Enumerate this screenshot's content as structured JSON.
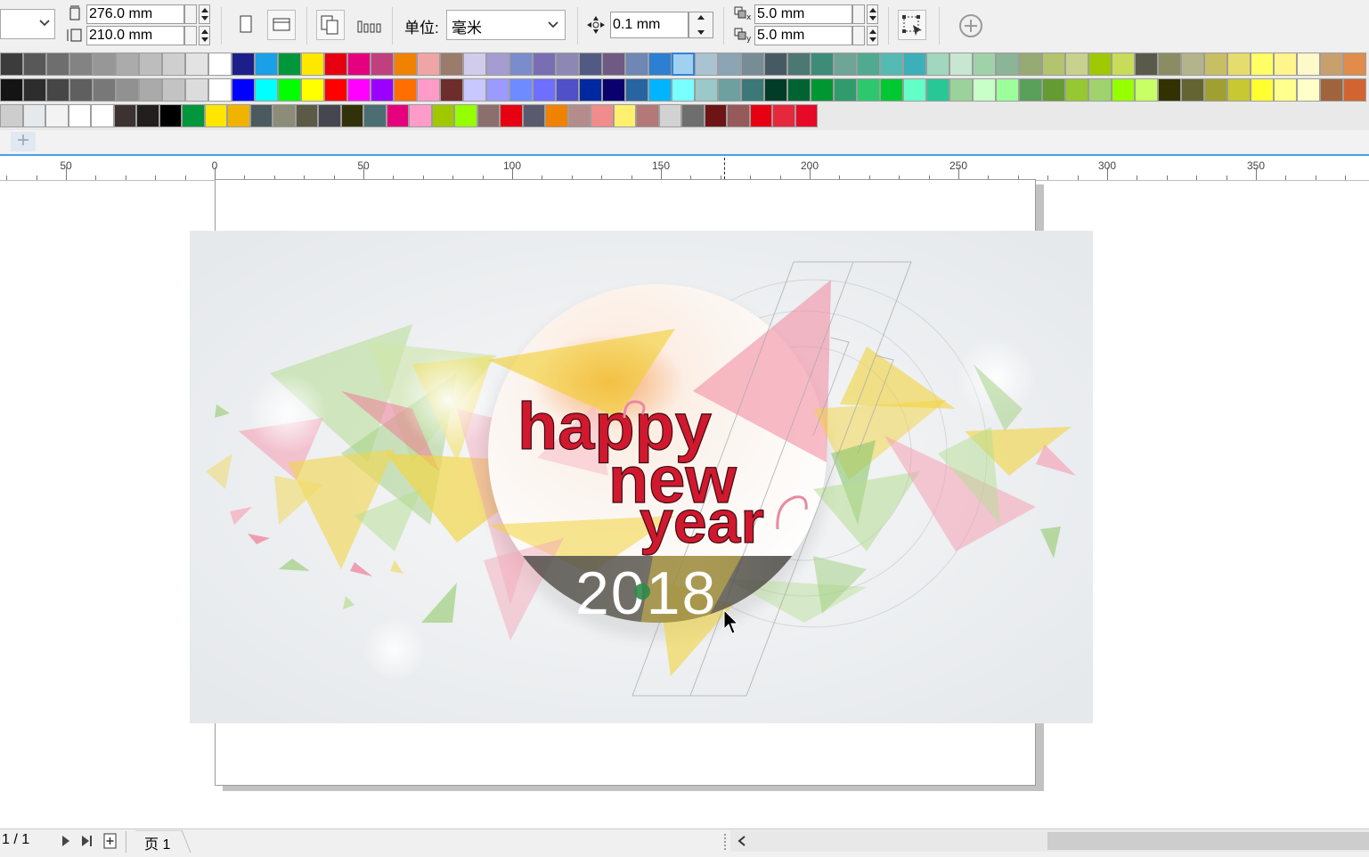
{
  "propbar": {
    "width_value": "276.0 mm",
    "height_value": "210.0 mm",
    "unit_label": "单位:",
    "unit_value": "毫米",
    "nudge_value": "0.1 mm",
    "dup_x_value": "5.0 mm",
    "dup_y_value": "5.0 mm"
  },
  "palette": {
    "row1": [
      "#3c3c3c",
      "#585858",
      "#6e6e6e",
      "#838383",
      "#979797",
      "#ababab",
      "#bdbdbd",
      "#cfcfcf",
      "#e3e3e3",
      "#ffffff",
      "#1c1f8a",
      "#1aa0e6",
      "#00963c",
      "#ffe800",
      "#e60012",
      "#e4007f",
      "#c0407f",
      "#f08200",
      "#f0a5a5",
      "#9b7b6c",
      "#d2ccec",
      "#a59cd2",
      "#7a8ccc",
      "#786eb4",
      "#8c87b4",
      "#505a82",
      "#6e5a82",
      "#6e87b4",
      "#2d7fd2",
      "#a0d2f0",
      "#aac3d2",
      "#8ca5b4",
      "#788c96",
      "#465a64",
      "#4b7873",
      "#3c8c78",
      "#6ea596",
      "#50aa91",
      "#55b9b4",
      "#3cafb9",
      "#a0d7be",
      "#c8e6d2",
      "#a0d2aa",
      "#8cb496",
      "#96aa73",
      "#b4c36e",
      "#c8d28c",
      "#a0c800",
      "#c8dc5a",
      "#5a5a4b",
      "#8c8c64",
      "#b4b48c",
      "#c8be64",
      "#e6dc6e",
      "#ffff64",
      "#fff58c",
      "#fff8c8",
      "#c8a06e",
      "#e18c4b"
    ],
    "row2": [
      "#141414",
      "#2d2d2d",
      "#464646",
      "#5f5f5f",
      "#787878",
      "#919191",
      "#aaaaaa",
      "#c3c3c3",
      "#dcdcdc",
      "#ffffff",
      "#0000ff",
      "#00ffff",
      "#00ff00",
      "#ffff00",
      "#ff0000",
      "#ff00ff",
      "#9b00ff",
      "#ff6e00",
      "#ff9bc8",
      "#6e2d2d",
      "#c8c8ff",
      "#9b9bff",
      "#6e8cff",
      "#6e6eff",
      "#5050c8",
      "#0028a0",
      "#0a006e",
      "#2864a0",
      "#00b4ff",
      "#78ffff",
      "#9bc8c8",
      "#6ea0a0",
      "#3c7878",
      "#003c28",
      "#006432",
      "#009632",
      "#329b6e",
      "#2dc86e",
      "#00c832",
      "#64ffc8",
      "#28c896",
      "#9bd29b",
      "#c8ffc8",
      "#9bff9b",
      "#5aa05a",
      "#649b32",
      "#96c832",
      "#a0d26e",
      "#96ff00",
      "#c8ff64",
      "#323200",
      "#646432",
      "#a0a032",
      "#c8c832",
      "#ffff32",
      "#ffff8c",
      "#ffffc8",
      "#a0643c",
      "#d26432"
    ],
    "row3": [
      "#cdcdcd",
      "#e6e9ec",
      "#f3f3f3",
      "#ffffff",
      "#ffffff",
      "#3c3232",
      "#231e1e",
      "#000000",
      "#00963c",
      "#ffe600",
      "#f0b400",
      "#4b5a5f",
      "#8c8c78",
      "#5a5a46",
      "#464650",
      "#32320a",
      "#4b6e73",
      "#e6007d",
      "#ff9bc8",
      "#a0c800",
      "#96ff00",
      "#8c6e6e",
      "#e60012",
      "#5a5a6e",
      "#f08200",
      "#b48c8c",
      "#f08c8c",
      "#fff06e",
      "#b47878",
      "#d2d2d2",
      "#6e6e6e",
      "#6e1414",
      "#965a5a",
      "#e60012",
      "#e6283c",
      "#e60a28"
    ]
  },
  "ruler": {
    "labels": [
      {
        "text": "50",
        "mm": -50
      },
      {
        "text": "0",
        "mm": 0
      },
      {
        "text": "50",
        "mm": 50
      },
      {
        "text": "100",
        "mm": 100
      },
      {
        "text": "150",
        "mm": 150
      },
      {
        "text": "200",
        "mm": 200
      },
      {
        "text": "250",
        "mm": 250
      },
      {
        "text": "300",
        "mm": 300
      },
      {
        "text": "350",
        "mm": 350
      }
    ]
  },
  "artwork": {
    "line1": "happy",
    "line2": "new",
    "line3": "year",
    "year": "2018"
  },
  "statusbar": {
    "page_count": "1 / 1",
    "page_tab": "页 1"
  }
}
